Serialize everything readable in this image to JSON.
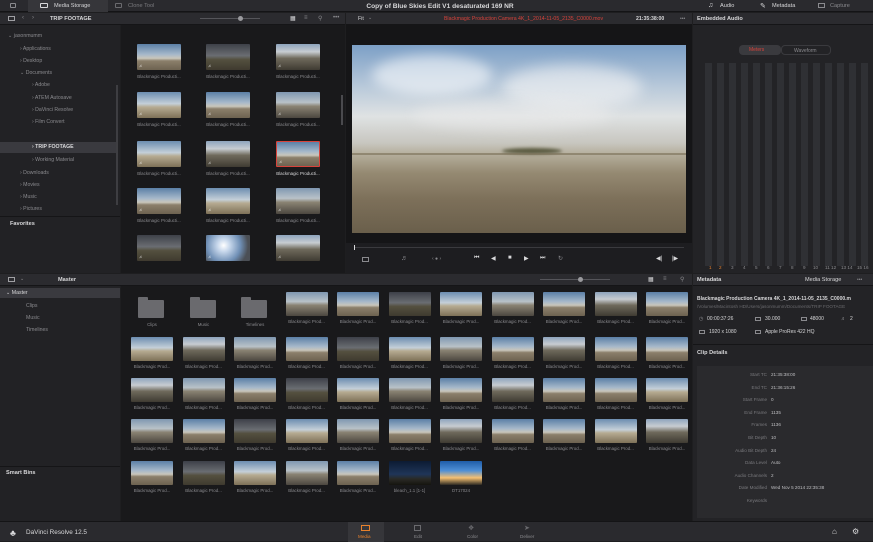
{
  "topbar": {
    "media_storage": "Media Storage",
    "clone_tool": "Clone Tool",
    "title": "Copy of Blue Skies Edit V1 desaturated 169 NR",
    "audio": "Audio",
    "metadata": "Metadata",
    "capture": "Capture"
  },
  "browser": {
    "folder": "TRIP FOOTAGE",
    "tree": [
      "jasonmumm",
      "Applications",
      "Desktop",
      "Documents",
      "Adobe",
      "ATEM Autosave",
      "DaVinci Resolve",
      "Film Convert",
      "TRIP FOOTAGE",
      "Working Material",
      "Downloads",
      "Movies",
      "Music",
      "Pictures"
    ],
    "favorites": "Favorites",
    "thumb_caption": "Blackmagic Producti..."
  },
  "viewer": {
    "zoom": "Fit",
    "clip_name": "Blackmagic Production Camera 4K_1_2014-11-05_2135_C0000.mov",
    "timecode": "21:35:38:00",
    "dots": "•••",
    "center": "‹ ● ›"
  },
  "audio_panel": {
    "title": "Embedded Audio",
    "tab_meters": "Meters",
    "tab_waveform": "Waveform",
    "channels": [
      "1",
      "2",
      "3",
      "4",
      "5",
      "6",
      "7",
      "8",
      "9",
      "10",
      "11 12",
      "13 14",
      "15 16"
    ]
  },
  "pool": {
    "title": "Master",
    "bins": [
      "Master",
      "Clips",
      "Music",
      "Timelines"
    ],
    "smart_bins": "Smart Bins",
    "folders": [
      "Clips",
      "Music",
      "Timelines"
    ],
    "clip_caption": "Blackmagic Prod...",
    "clip_caption_long": "Blackmagic Prod...",
    "extra_clips": [
      "bleach_1.1 [1-1]",
      "DT17024"
    ]
  },
  "metadata": {
    "title": "Metadata",
    "media_storage": "Media Storage",
    "clip_name": "Blackmagic Production Camera 4K_1_2014-11-05_2135_C0000.m",
    "path": "/Volumes/Macintosh HD/Users/jasonmumm/Documents/TRIP FOOTAGE",
    "duration": "00:00:37:26",
    "fps": "30.000",
    "audio_rate": "48000",
    "channels": "2",
    "resolution": "1920 x 1080",
    "codec": "Apple ProRes 422 HQ",
    "clip_details": "Clip Details",
    "details": [
      {
        "label": "Start TC",
        "value": "21:35:38:00"
      },
      {
        "label": "End TC",
        "value": "21:36:15:26"
      },
      {
        "label": "Start Frame",
        "value": "0"
      },
      {
        "label": "End Frame",
        "value": "1135"
      },
      {
        "label": "Frames",
        "value": "1136"
      },
      {
        "label": "Bit Depth",
        "value": "10"
      },
      {
        "label": "Audio Bit Depth",
        "value": "24"
      },
      {
        "label": "Data Level",
        "value": "Auto"
      },
      {
        "label": "Audio Channels",
        "value": "2"
      },
      {
        "label": "Date Modified",
        "value": "Wed Nov 5 2014 22:35:38"
      },
      {
        "label": "Keywords",
        "value": ""
      }
    ]
  },
  "bottom": {
    "app": "DaVinci Resolve 12.5",
    "pages": [
      "Media",
      "Edit",
      "Color",
      "Deliver"
    ]
  },
  "colors": {
    "accent_red": "#d8433b",
    "accent_orange": "#e8812c",
    "bg": "#1e1e20"
  }
}
